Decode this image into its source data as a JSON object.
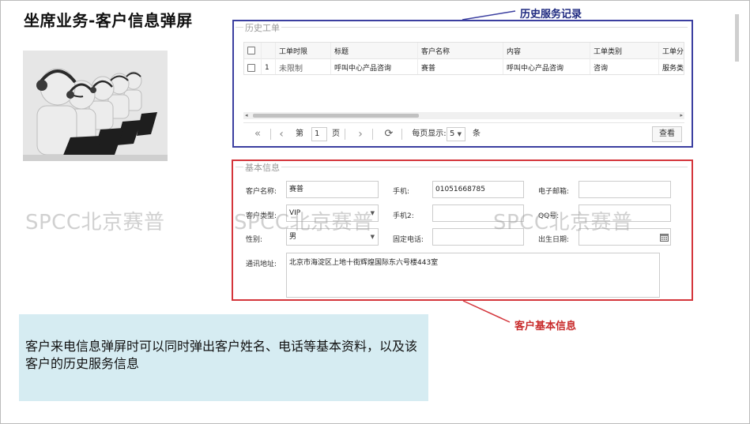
{
  "slide": {
    "title": "坐席业务-客户信息弹屏",
    "callouts": {
      "history": "历史服务记录",
      "basic": "客户基本信息"
    },
    "description": "客户来电信息弹屏时可以同时弹出客户姓名、电话等基本资料，以及该客户的历史服务信息",
    "watermark": "SPCC北京赛普"
  },
  "history": {
    "legend": "历史工单",
    "columns": [
      "工单时限",
      "标题",
      "客户名称",
      "内容",
      "工单类别",
      "工单分"
    ],
    "rows": [
      {
        "index": "1",
        "time_limit": "未限制",
        "title": "呼叫中心产品咨询",
        "customer": "赛普",
        "content": "呼叫中心产品咨询",
        "category": "咨询",
        "sub": "服务类"
      }
    ],
    "pager": {
      "first_icon": "«",
      "prev_icon": "‹",
      "page_prefix": "第",
      "page_value": "1",
      "page_suffix": "页",
      "next_icon": "›",
      "refresh_icon": "⟳",
      "per_page_label": "每页显示:",
      "per_page_value": "5",
      "per_page_unit": "条",
      "query_label": "查看"
    }
  },
  "basic": {
    "legend": "基本信息",
    "fields": {
      "name_label": "客户名称:",
      "name_value": "赛普",
      "mobile_label": "手机:",
      "mobile_value": "01051668785",
      "email_label": "电子邮箱:",
      "email_value": "",
      "type_label": "客户类型:",
      "type_value": "VIP",
      "mobile2_label": "手机2:",
      "mobile2_value": "",
      "qq_label": "QQ号:",
      "qq_value": "",
      "gender_label": "性别:",
      "gender_value": "男",
      "phone_label": "固定电话:",
      "phone_value": "",
      "birth_label": "出生日期:",
      "birth_value": "",
      "address_label": "通讯地址:",
      "address_value": "北京市海淀区上地十街辉煌国际东六号楼443室"
    }
  },
  "colors": {
    "history_border": "#3b3fa0",
    "basic_border": "#d4353b",
    "info_bg": "#d6ecf2"
  },
  "icons": [
    "headset-agent-illustration",
    "calendar-icon",
    "chevron-down-icon",
    "refresh-icon"
  ]
}
